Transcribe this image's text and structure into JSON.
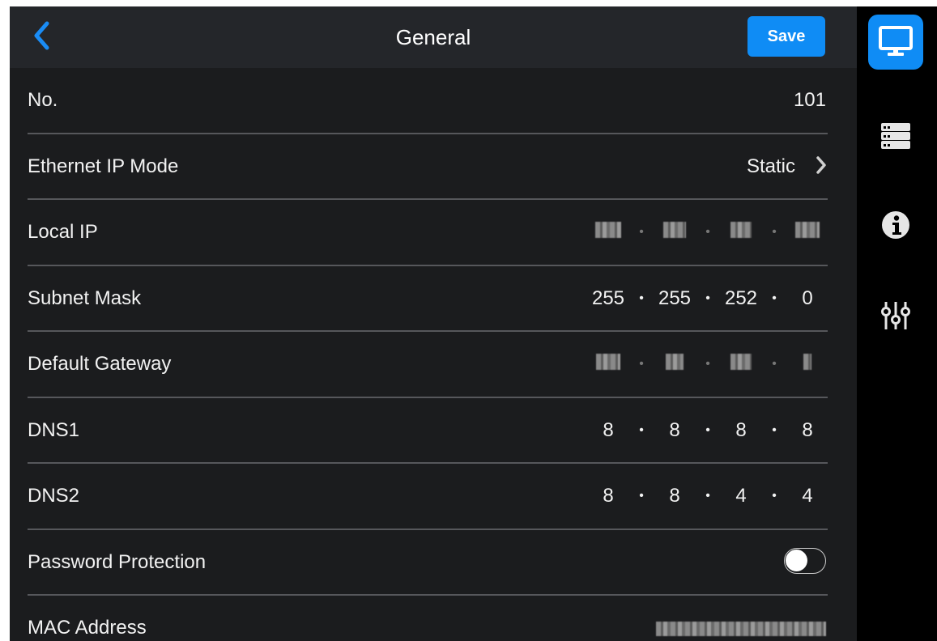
{
  "header": {
    "title": "General",
    "save_label": "Save"
  },
  "settings": {
    "no": {
      "label": "No.",
      "value": "101"
    },
    "ethernet_ip_mode": {
      "label": "Ethernet IP Mode",
      "value": "Static"
    },
    "local_ip": {
      "label": "Local IP"
    },
    "subnet_mask": {
      "label": "Subnet Mask",
      "octets": [
        "255",
        "255",
        "252",
        "0"
      ]
    },
    "default_gateway": {
      "label": "Default Gateway"
    },
    "dns1": {
      "label": "DNS1",
      "octets": [
        "8",
        "8",
        "8",
        "8"
      ]
    },
    "dns2": {
      "label": "DNS2",
      "octets": [
        "8",
        "8",
        "4",
        "4"
      ]
    },
    "password_protection": {
      "label": "Password Protection",
      "enabled": false
    },
    "mac_address": {
      "label": "MAC Address"
    }
  },
  "sidebar": {
    "items": [
      {
        "icon": "monitor-icon",
        "active": true
      },
      {
        "icon": "server-icon",
        "active": false
      },
      {
        "icon": "info-icon",
        "active": false
      },
      {
        "icon": "sliders-icon",
        "active": false
      }
    ]
  },
  "colors": {
    "accent": "#0f8cf5",
    "background": "#1b1c1e",
    "topbar": "#24262a",
    "sidebar": "#000000"
  }
}
